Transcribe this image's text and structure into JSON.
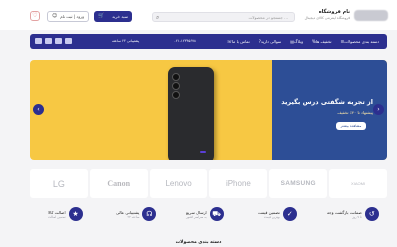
{
  "header": {
    "brand_name": "نام فروشگاه",
    "brand_tagline": "فروشگاه اینترنتی کالای دیجیتال",
    "search_placeholder": "جستجو در محصولات ...",
    "login_label": "ورود | ثبت نام",
    "cart_label": "سبد خرید"
  },
  "nav": {
    "items": [
      {
        "label": "دسته بندی محصولات",
        "icon": "menu-icon"
      },
      {
        "label": "تخفیف ها",
        "icon": "percent-icon"
      },
      {
        "label": "وبلاگ",
        "icon": "blog-icon"
      },
      {
        "label": "سوالی دارید",
        "icon": "question-icon"
      },
      {
        "label": "تماس با ما",
        "icon": "phone-icon"
      }
    ],
    "support_label": "پشتیبانی ۲۴ ساعته",
    "phone_label": "۰۲۱-۱۲۳۴۵۶۷۸"
  },
  "banner": {
    "title": "از تجربه شگفتی درس بگیرید",
    "subtitle": "پیشنهاد تا ۴۰٪ تخفیف",
    "cta": "مشاهده بیشتر"
  },
  "brands": [
    "LG",
    "Canon",
    "Lenovo",
    " iPhone",
    "SAMSUNG",
    "XIAOMI"
  ],
  "features": [
    {
      "title": "ضمانت بازگشت وجه",
      "sub": "تا ۷ روز",
      "icon": "refund-icon"
    },
    {
      "title": "تضمین قیمت",
      "sub": "بهترین قیمت",
      "icon": "tag-icon"
    },
    {
      "title": "ارسال سریع",
      "sub": "به سراسر کشور",
      "icon": "truck-icon"
    },
    {
      "title": "پشتیبانی عالی",
      "sub": "۲۴ ساعته",
      "icon": "headset-icon"
    },
    {
      "title": "اصالت کالا",
      "sub": "تضمین اصالت",
      "icon": "badge-icon"
    }
  ],
  "section_title": "دسته بندی محصولات",
  "colors": {
    "primary": "#2c2f8f",
    "banner_yellow": "#f7c843",
    "banner_blue": "#2d4e96"
  }
}
